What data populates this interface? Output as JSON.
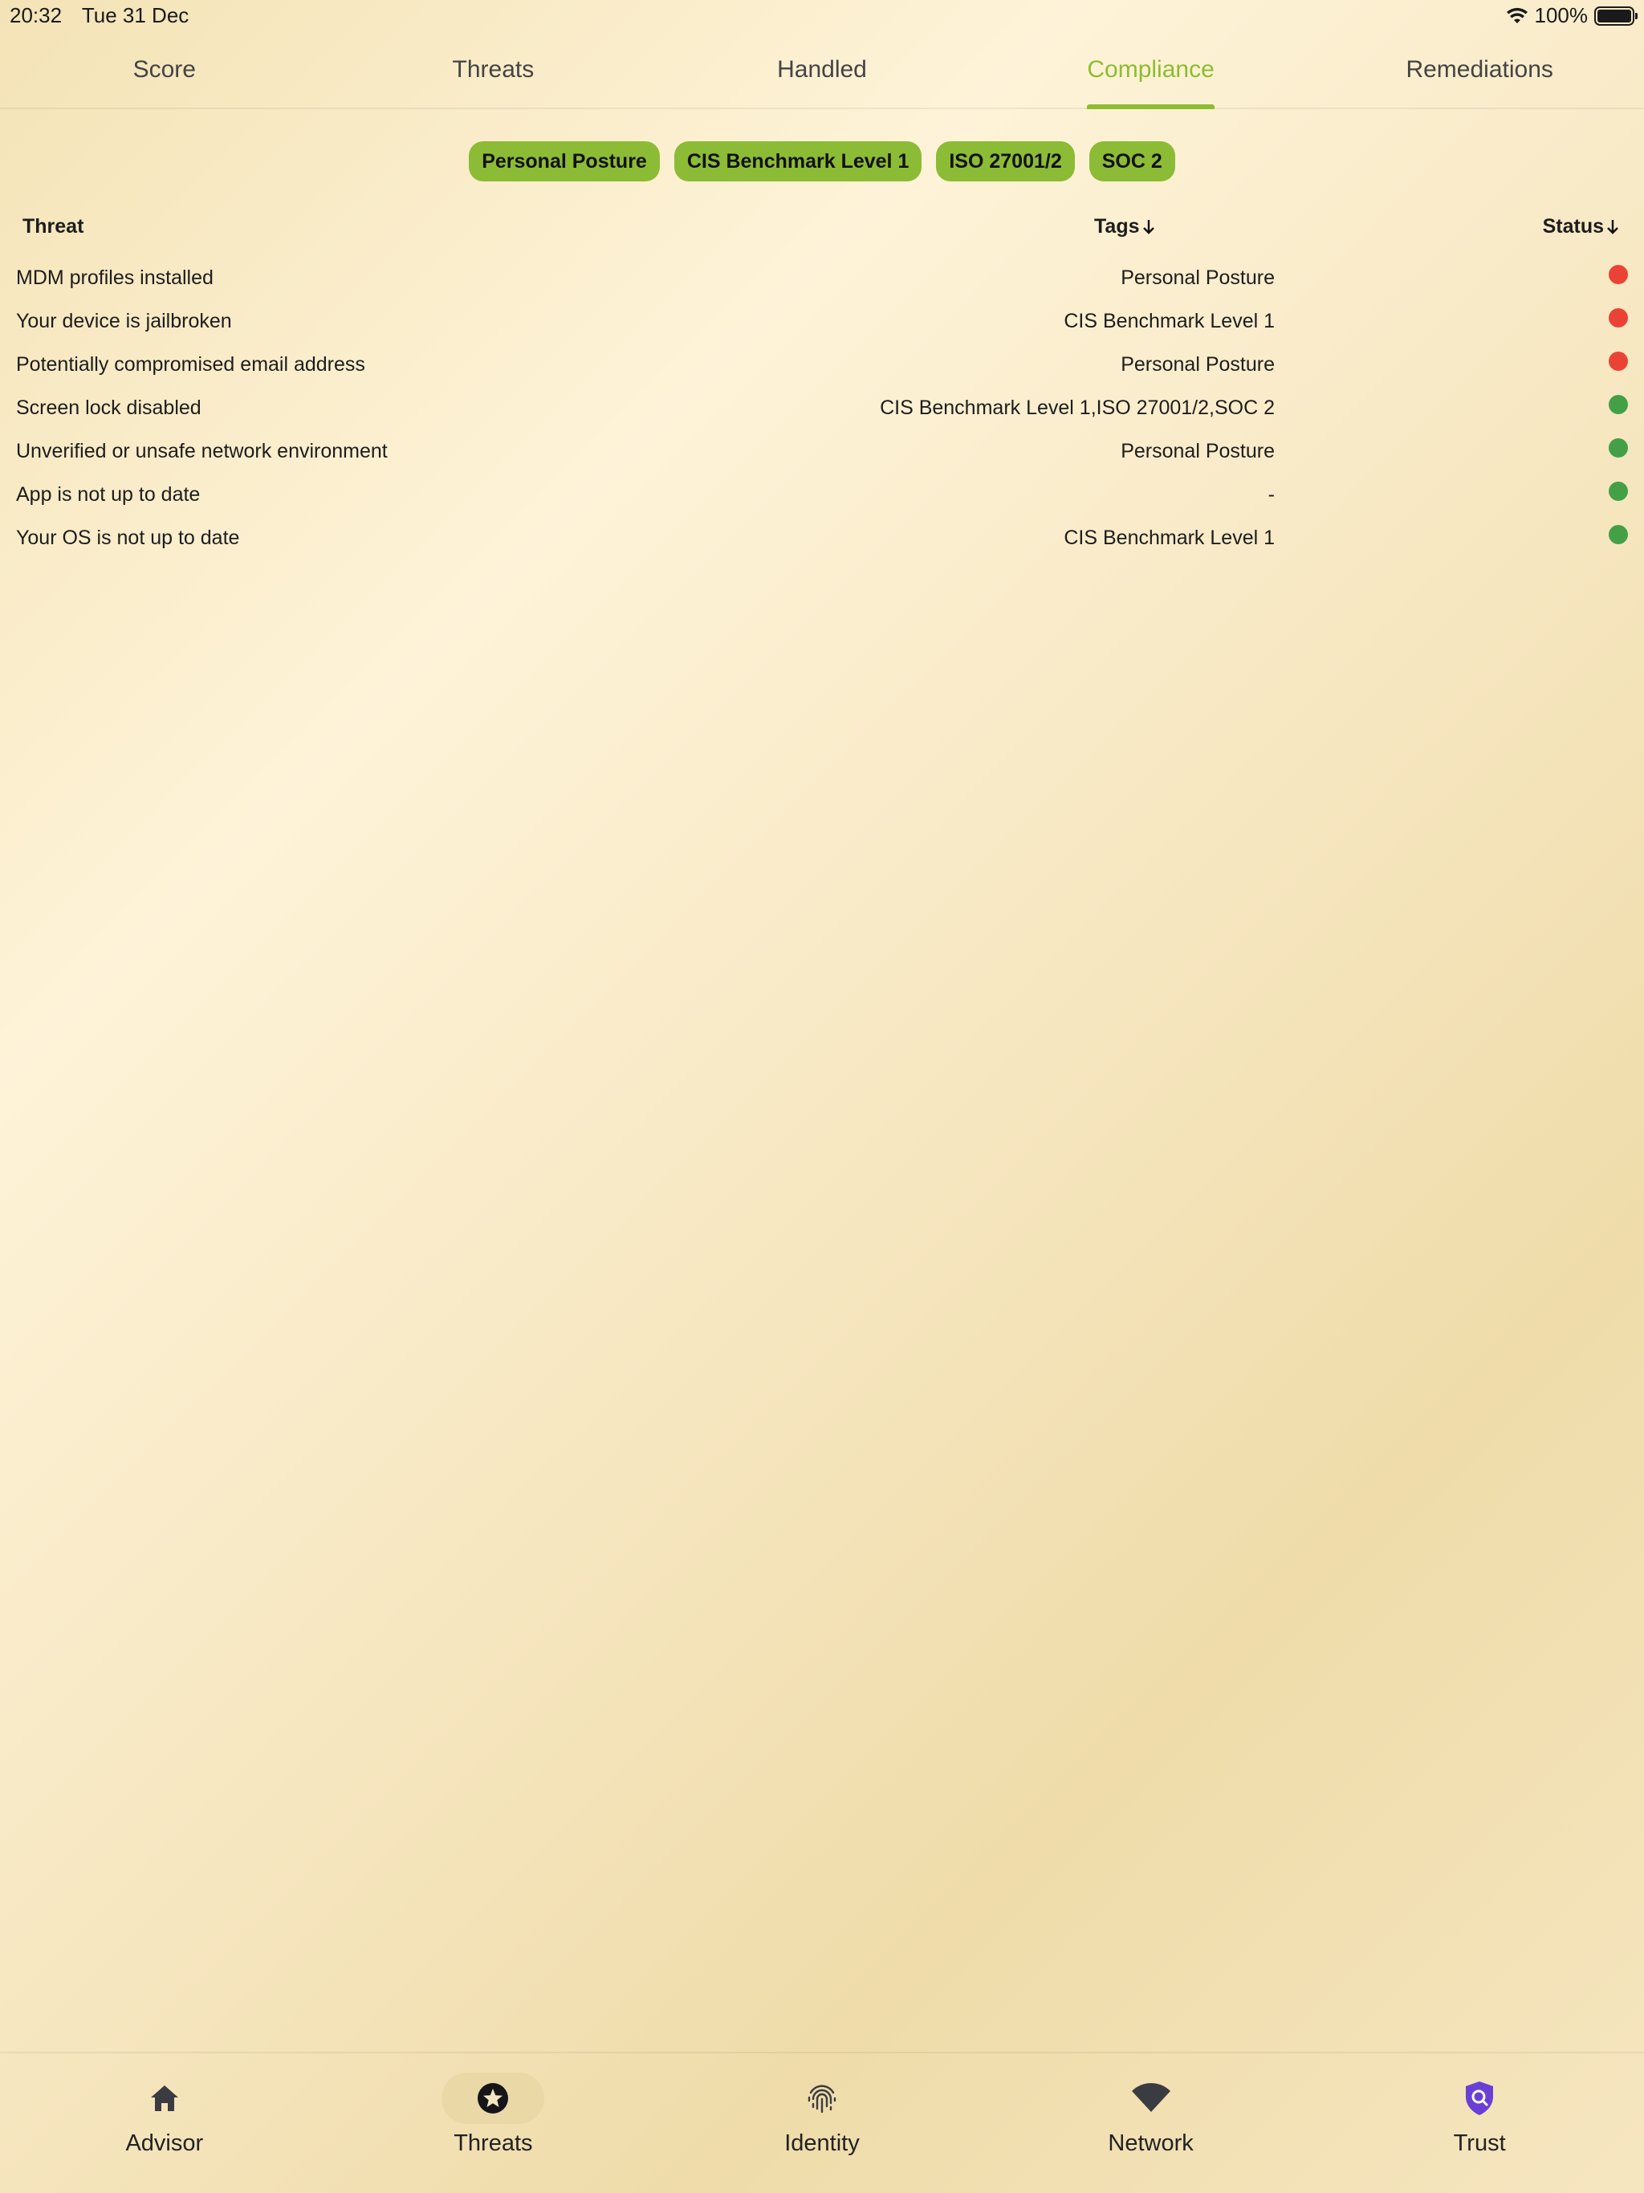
{
  "status_bar": {
    "time": "20:32",
    "date": "Tue 31 Dec",
    "battery": "100%",
    "icons": [
      "wifi-icon",
      "battery-icon"
    ]
  },
  "top_tabs": [
    {
      "label": "Score",
      "active": false
    },
    {
      "label": "Threats",
      "active": false
    },
    {
      "label": "Handled",
      "active": false
    },
    {
      "label": "Compliance",
      "active": true
    },
    {
      "label": "Remediations",
      "active": false
    }
  ],
  "filters": [
    "Personal Posture",
    "CIS Benchmark Level 1",
    "ISO 27001/2",
    "SOC 2"
  ],
  "table": {
    "headers": {
      "threat": "Threat",
      "tags": "Tags",
      "status": "Status"
    },
    "sort_icon": "arrow-down-icon",
    "rows": [
      {
        "threat": "MDM profiles installed",
        "tags": "Personal Posture",
        "status": "red"
      },
      {
        "threat": "Your device is jailbroken",
        "tags": "CIS Benchmark Level 1",
        "status": "red"
      },
      {
        "threat": "Potentially compromised email address",
        "tags": "Personal Posture",
        "status": "red"
      },
      {
        "threat": "Screen lock disabled",
        "tags": "CIS Benchmark Level 1,ISO 27001/2,SOC 2",
        "status": "green"
      },
      {
        "threat": "Unverified or unsafe network environment",
        "tags": "Personal Posture",
        "status": "green"
      },
      {
        "threat": "App is not up to date",
        "tags": "-",
        "status": "green"
      },
      {
        "threat": "Your OS is not up to date",
        "tags": "CIS Benchmark Level 1",
        "status": "green"
      }
    ]
  },
  "bottom_nav": [
    {
      "label": "Advisor",
      "icon": "home-icon",
      "active": false
    },
    {
      "label": "Threats",
      "icon": "star-badge-icon",
      "active": true
    },
    {
      "label": "Identity",
      "icon": "fingerprint-icon",
      "active": false
    },
    {
      "label": "Network",
      "icon": "wifi-icon",
      "active": false
    },
    {
      "label": "Trust",
      "icon": "shield-search-icon",
      "active": false
    }
  ],
  "colors": {
    "accent": "#8cbd2f",
    "chip": "#8cbb35",
    "status_red": "#ea4335",
    "status_green": "#43a047",
    "trust_icon": "#6a3fd6"
  }
}
